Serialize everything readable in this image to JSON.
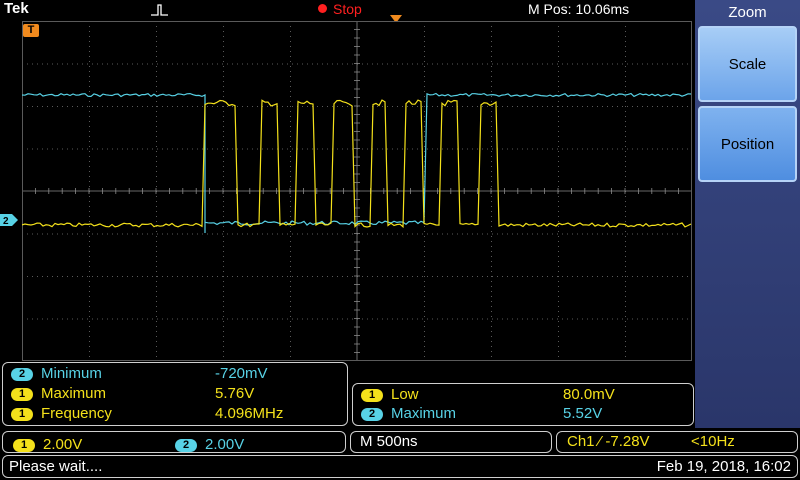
{
  "header": {
    "brand": "Tek",
    "run_state": "Stop",
    "position": "M Pos: 10.06ms"
  },
  "screen": {
    "trigger_marker": "T",
    "ch2_marker": "2",
    "channel_colors": {
      "ch1": "#f4e11b",
      "ch2": "#58d2e6"
    }
  },
  "side_menu": {
    "title": "Zoom",
    "buttons": [
      "Scale",
      "Position"
    ]
  },
  "measurements_left": [
    {
      "channel": "2",
      "label": "Minimum",
      "value": "-720mV"
    },
    {
      "channel": "1",
      "label": "Maximum",
      "value": "5.76V"
    },
    {
      "channel": "1",
      "label": "Frequency",
      "value": "4.096MHz"
    }
  ],
  "measurements_right": [
    {
      "channel": "1",
      "label": "Low",
      "value": "80.0mV"
    },
    {
      "channel": "2",
      "label": "Maximum",
      "value": "5.52V"
    }
  ],
  "status": {
    "ch1_channel": "1",
    "ch1_scale": "2.00V",
    "ch2_channel": "2",
    "ch2_scale": "2.00V",
    "timebase": "M 500ns",
    "trigger": "Ch1 ⁄ -7.28V",
    "trigger_freq": "<10Hz"
  },
  "footer": {
    "message": "Please wait....",
    "datetime": "Feb 19, 2018, 16:02"
  }
}
